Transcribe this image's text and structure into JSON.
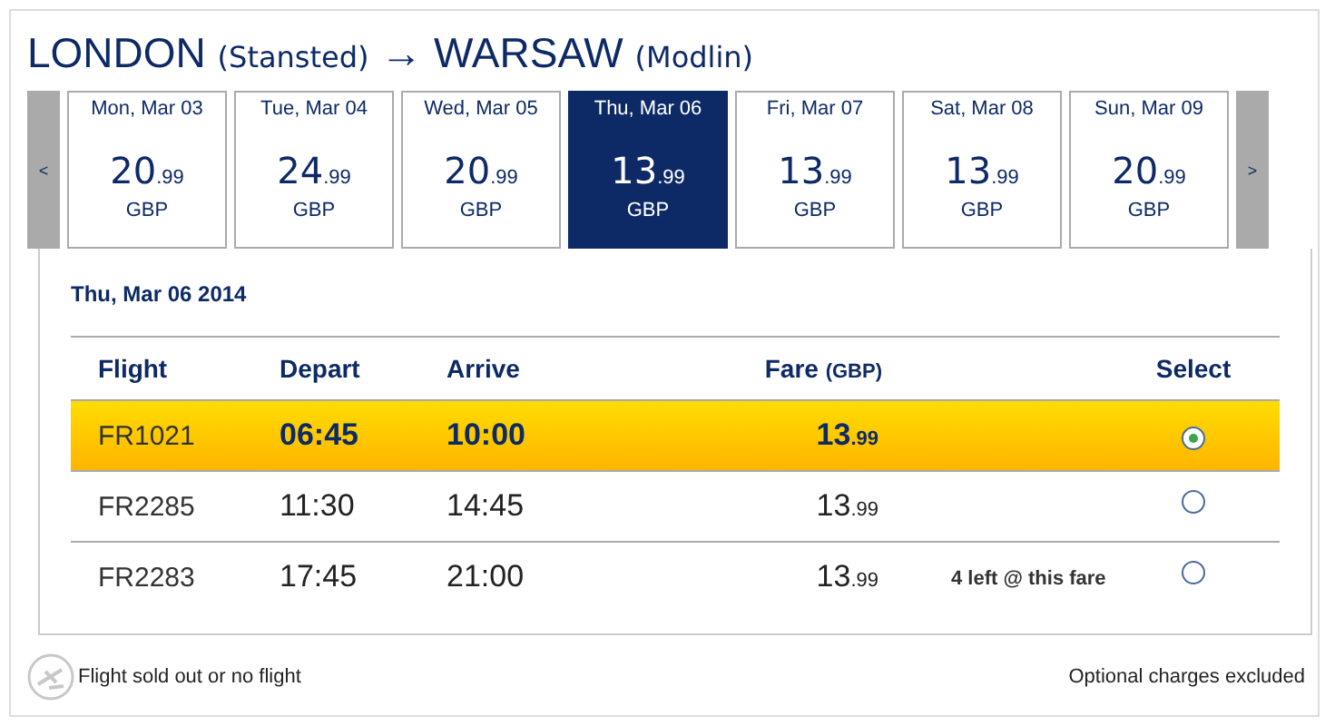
{
  "route": {
    "origin": "LONDON",
    "origin_airport": "(Stansted)",
    "arrow": "→",
    "destination": "WARSAW",
    "destination_airport": "(Modlin)"
  },
  "date_strip": {
    "prev": "<",
    "next": ">",
    "days": [
      {
        "date": "Mon, Mar 03",
        "price": "20",
        "cents": ".99",
        "currency": "GBP",
        "selected": false
      },
      {
        "date": "Tue, Mar 04",
        "price": "24",
        "cents": ".99",
        "currency": "GBP",
        "selected": false
      },
      {
        "date": "Wed, Mar 05",
        "price": "20",
        "cents": ".99",
        "currency": "GBP",
        "selected": false
      },
      {
        "date": "Thu, Mar 06",
        "price": "13",
        "cents": ".99",
        "currency": "GBP",
        "selected": true
      },
      {
        "date": "Fri, Mar 07",
        "price": "13",
        "cents": ".99",
        "currency": "GBP",
        "selected": false
      },
      {
        "date": "Sat, Mar 08",
        "price": "13",
        "cents": ".99",
        "currency": "GBP",
        "selected": false
      },
      {
        "date": "Sun, Mar 09",
        "price": "20",
        "cents": ".99",
        "currency": "GBP",
        "selected": false
      }
    ]
  },
  "selected_date": "Thu, Mar 06 2014",
  "table": {
    "columns": {
      "flight": "Flight",
      "depart": "Depart",
      "arrive": "Arrive",
      "fare": "Fare",
      "fare_unit": "(GBP)",
      "select": "Select"
    },
    "rows": [
      {
        "flight": "FR1021",
        "depart": "06:45",
        "arrive": "10:00",
        "fare": "13",
        "cents": ".99",
        "selected": true
      },
      {
        "flight": "FR2285",
        "depart": "11:30",
        "arrive": "14:45",
        "fare": "13",
        "cents": ".99",
        "selected": false
      },
      {
        "flight": "FR2283",
        "depart": "17:45",
        "arrive": "21:00",
        "fare": "13",
        "cents": ".99",
        "note": "4 left @ this fare",
        "selected": false
      }
    ]
  },
  "legend": "Flight sold out or no flight",
  "footnote": "Optional charges excluded"
}
